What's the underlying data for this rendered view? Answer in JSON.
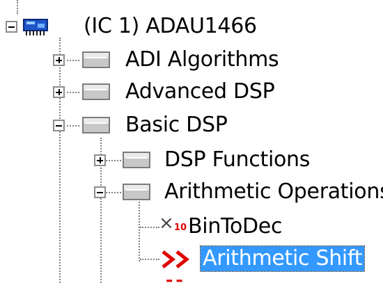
{
  "tree": {
    "root": {
      "label": "(IC 1) ADAU1466",
      "expanded": true,
      "icon": "ic-chip-icon"
    },
    "items": [
      {
        "label": "ADI Algorithms",
        "expanded": false,
        "icon": "folder-icon"
      },
      {
        "label": "Advanced DSP",
        "expanded": false,
        "icon": "folder-icon"
      },
      {
        "label": "Basic DSP",
        "expanded": true,
        "icon": "folder-icon"
      },
      {
        "label": "DSP Functions",
        "expanded": false,
        "icon": "folder-icon"
      },
      {
        "label": "Arithmetic Operations",
        "expanded": true,
        "icon": "folder-icon"
      },
      {
        "label": "BinToDec",
        "icon": "bin-to-dec-icon",
        "icon_subscript": "10"
      },
      {
        "label": "Arithmetic Shift",
        "icon": "arithmetic-shift-icon",
        "selected": true
      }
    ]
  },
  "colors": {
    "selection": "#3399ff",
    "accent_red": "#e00000",
    "tree_lines": "#808080"
  }
}
